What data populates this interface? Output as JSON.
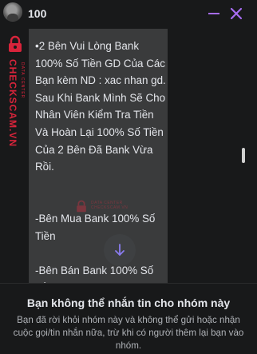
{
  "header": {
    "title": "100",
    "avatar_icon": "avatar-icon",
    "minimize_icon": "minimize-icon",
    "close_icon": "close-icon",
    "accent_color": "#a66cf0"
  },
  "brand": {
    "name": "CHECKSCAM.VN",
    "subtitle": "DATA CENTER",
    "color": "#d8243b"
  },
  "message": {
    "text": "•2 Bên Vui Lòng Bank 100% Số Tiền GD Của Các Bạn kèm ND : xac nhan gd. Sau Khi Bank Mình Sẽ Cho Nhân Viên Kiểm Tra Tiền Và Hoàn Lại 100% Số Tiền Của 2 Bên Đã Bank Vừa Rồi.\n\n\n-Bên Mua Bank 100% Số Tiền\n\n-Bên Bán Bank 100% Số Tiền",
    "watermark_text": "DATA CENTER CHECKSCAM.VN"
  },
  "scroll_down_icon": "arrow-down-icon",
  "footer": {
    "title": "Bạn không thể nhắn tin cho nhóm này",
    "description": "Bạn đã rời khỏi nhóm này và không thể gửi hoặc nhận cuộc gọi/tin nhắn nữa, trừ khi có người thêm lại bạn vào nhóm."
  }
}
